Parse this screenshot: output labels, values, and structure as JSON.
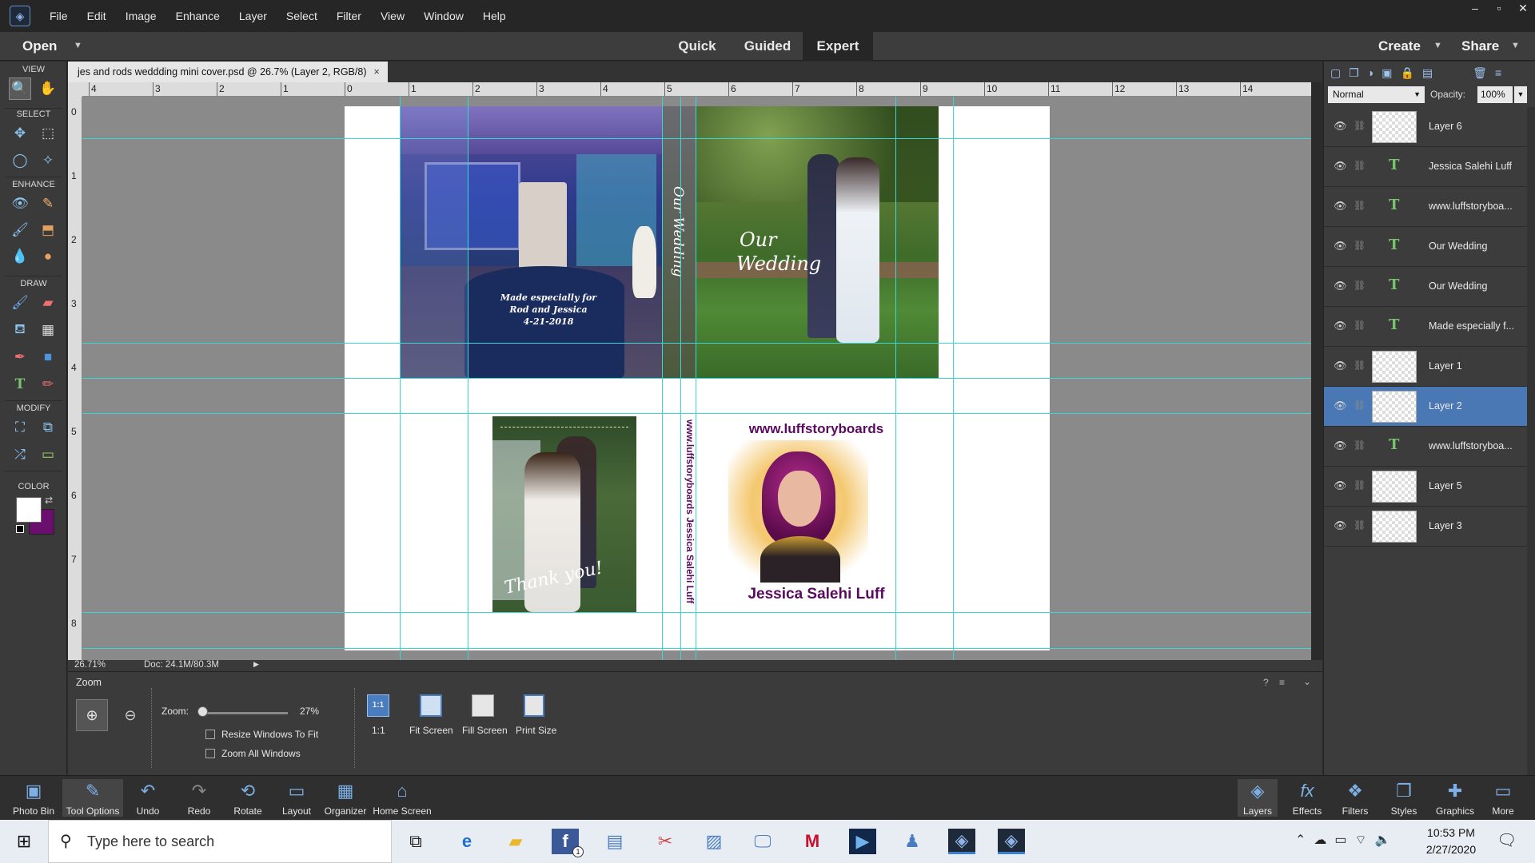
{
  "menubar": {
    "items": [
      "File",
      "Edit",
      "Image",
      "Enhance",
      "Layer",
      "Select",
      "Filter",
      "View",
      "Window",
      "Help"
    ],
    "window_controls": [
      "–",
      "▫",
      "✕"
    ]
  },
  "modebar": {
    "open_label": "Open",
    "tabs": [
      "Quick",
      "Guided",
      "Expert"
    ],
    "active_tab": "Expert",
    "create_label": "Create",
    "share_label": "Share"
  },
  "toolbar": {
    "sections": [
      "VIEW",
      "SELECT",
      "ENHANCE",
      "DRAW",
      "MODIFY",
      "COLOR"
    ],
    "foreground_color": "#ffffff",
    "background_color": "#6a0f6e"
  },
  "document": {
    "tab_title": "jes and rods weddding mini cover.psd @ 26.7% (Layer 2, RGB/8)",
    "close": "×",
    "zoom_display": "26.71%",
    "doc_size": "Doc: 24.1M/80.3M",
    "ruler_top": [
      "4",
      "3",
      "2",
      "1",
      "0",
      "1",
      "2",
      "3",
      "4",
      "5",
      "6",
      "7",
      "8",
      "9",
      "10",
      "11",
      "12",
      "13",
      "14"
    ],
    "ruler_left": [
      "0",
      "1",
      "2",
      "3",
      "4",
      "5",
      "6",
      "7",
      "8"
    ]
  },
  "artwork": {
    "cover_title_line1": "Our",
    "cover_title_line2": "Wedding",
    "spine_title": "Our Wedding",
    "made_line1": "Made especially for",
    "made_line2": "Rod and Jessica",
    "made_line3": "4-21-2018",
    "website": "www.luffstoryboards",
    "author": "Jessica Salehi Luff",
    "spine_back": "www.luffstoryboards  Jessica Salehi Luff",
    "thank_you": "Thank you!"
  },
  "tool_options": {
    "tool_name": "Zoom",
    "zoom_label": "Zoom:",
    "zoom_value": "27%",
    "zoom_fraction": 0.27,
    "resize_windows": "Resize Windows To Fit",
    "zoom_all": "Zoom All Windows",
    "buttons": [
      "1:1",
      "Fit Screen",
      "Fill Screen",
      "Print Size"
    ],
    "btn_1to1_icon_text": "1:1"
  },
  "bottombar": {
    "left": [
      "Photo Bin",
      "Tool Options",
      "Undo",
      "Redo",
      "Rotate",
      "Layout",
      "Organizer",
      "Home Screen"
    ],
    "right": [
      "Layers",
      "Effects",
      "Filters",
      "Styles",
      "Graphics",
      "More"
    ]
  },
  "layers_panel": {
    "blend_mode": "Normal",
    "opacity_label": "Opacity:",
    "opacity_value": "100%",
    "layers": [
      {
        "name": "Layer 6",
        "kind": "image",
        "selected": false
      },
      {
        "name": "Jessica Salehi Luff",
        "kind": "text",
        "selected": false
      },
      {
        "name": "www.luffstoryboa...",
        "kind": "text",
        "selected": false
      },
      {
        "name": "Our Wedding",
        "kind": "text",
        "selected": false
      },
      {
        "name": "Our Wedding",
        "kind": "text",
        "selected": false
      },
      {
        "name": "Made especially f...",
        "kind": "text",
        "selected": false
      },
      {
        "name": "Layer 1",
        "kind": "image",
        "selected": false
      },
      {
        "name": "Layer 2",
        "kind": "image",
        "selected": true
      },
      {
        "name": "www.luffstoryboa...",
        "kind": "text",
        "selected": false
      },
      {
        "name": "Layer 5",
        "kind": "image",
        "selected": false
      },
      {
        "name": "Layer 3",
        "kind": "image",
        "selected": false
      }
    ]
  },
  "taskbar": {
    "search_placeholder": "Type here to search",
    "time": "10:53 PM",
    "date": "2/27/2020",
    "facebook_badge": "1"
  }
}
